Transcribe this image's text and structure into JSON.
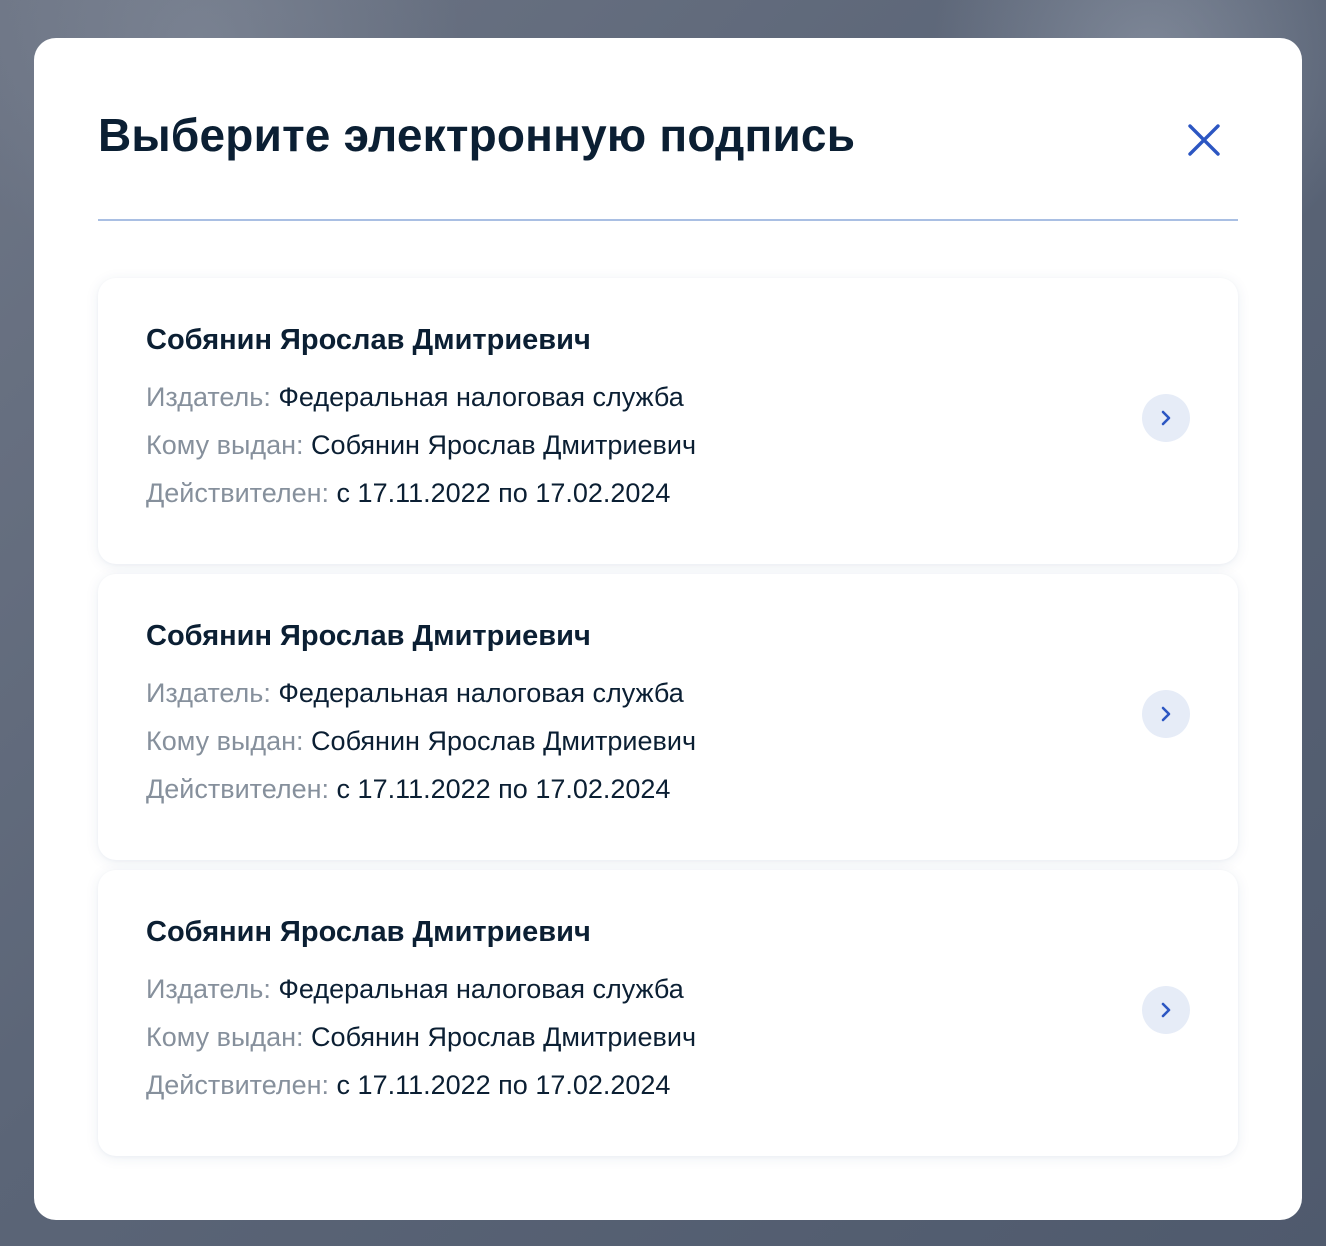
{
  "dialog": {
    "title": "Выберите электронную подпись",
    "close_icon": "close-icon"
  },
  "certificates": [
    {
      "name": "Собянин Ярослав Дмитриевич",
      "issuer_label": "Издатель:",
      "issuer_value": " Федеральная налоговая служба",
      "issued_to_label": "Кому выдан:",
      "issued_to_value": " Собянин Ярослав Дмитриевич",
      "valid_label": "Действителен:",
      "valid_value": " с 17.11.2022 по 17.02.2024",
      "action_icon": "chevron-right-icon"
    },
    {
      "name": "Собянин Ярослав Дмитриевич",
      "issuer_label": "Издатель:",
      "issuer_value": " Федеральная налоговая служба",
      "issued_to_label": "Кому выдан:",
      "issued_to_value": " Собянин Ярослав Дмитриевич",
      "valid_label": "Действителен:",
      "valid_value": " с 17.11.2022 по 17.02.2024",
      "action_icon": "chevron-right-icon"
    },
    {
      "name": "Собянин Ярослав Дмитриевич",
      "issuer_label": "Издатель:",
      "issuer_value": " Федеральная налоговая служба",
      "issued_to_label": "Кому выдан:",
      "issued_to_value": " Собянин Ярослав Дмитриевич",
      "valid_label": "Действителен:",
      "valid_value": " с 17.11.2022 по 17.02.2024",
      "action_icon": "chevron-right-icon"
    }
  ],
  "colors": {
    "title_text": "#0b1f33",
    "label_text": "#86909c",
    "accent": "#2c56c2",
    "chevron_bg": "#e6ecf7",
    "divider": "#a9bfe3",
    "overlay": "#5b6577"
  }
}
